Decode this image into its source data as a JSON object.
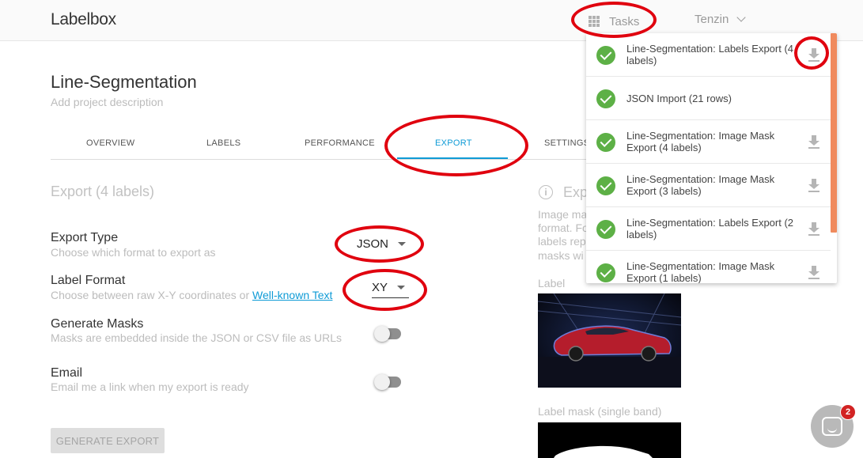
{
  "header": {
    "logo": "Labelbox",
    "tasks_label": "Tasks",
    "tasks_icon": "apps-grid-icon",
    "user_name": "Tenzin",
    "user_icon": "chevron-down-icon"
  },
  "project": {
    "title": "Line-Segmentation",
    "description_placeholder": "Add project description"
  },
  "tabs": [
    {
      "label": "OVERVIEW",
      "active": false
    },
    {
      "label": "LABELS",
      "active": false
    },
    {
      "label": "PERFORMANCE",
      "active": false
    },
    {
      "label": "EXPORT",
      "active": true
    },
    {
      "label": "SETTINGS",
      "active": false
    }
  ],
  "export_form": {
    "title": "Export (4 labels)",
    "export_type": {
      "title": "Export Type",
      "desc": "Choose which format to export as",
      "value": "JSON"
    },
    "label_format": {
      "title": "Label Format",
      "desc_prefix": "Choose between raw X-Y coordinates or ",
      "desc_link": "Well-known Text",
      "value": "XY"
    },
    "generate_masks": {
      "title": "Generate Masks",
      "desc": "Masks are embedded inside the JSON or CSV file as URLs",
      "enabled": false
    },
    "email": {
      "title": "Email",
      "desc": "Email me a link when my export is ready",
      "enabled": false
    },
    "generate_button": "GENERATE EXPORT"
  },
  "info_panel": {
    "title": "Exp",
    "lines": [
      "Image ma",
      "format. Fo",
      "labels rep",
      "masks wi"
    ],
    "label_caption": "Label",
    "mask_caption": "Label mask (single band)"
  },
  "tasks_dropdown": {
    "items": [
      {
        "text": "Line-Segmentation: Labels Export (4 labels)",
        "has_download": true
      },
      {
        "text": "JSON Import (21 rows)",
        "has_download": false
      },
      {
        "text": "Line-Segmentation: Image Mask Export (4 labels)",
        "has_download": true
      },
      {
        "text": "Line-Segmentation: Image Mask Export (3 labels)",
        "has_download": true
      },
      {
        "text": "Line-Segmentation: Labels Export (2 labels)",
        "has_download": true
      },
      {
        "text": "Line-Segmentation: Image Mask Export (1 labels)",
        "has_download": true
      }
    ],
    "status_icon": "check-circle-icon",
    "download_icon": "download-icon"
  },
  "chat": {
    "icon": "chat-bubble-icon",
    "badge_count": "2"
  },
  "colors": {
    "accent": "#0f9bd6",
    "success": "#5db046",
    "scrollbar": "#f08a5d",
    "annotation": "#e0000e",
    "badge": "#d22323"
  }
}
